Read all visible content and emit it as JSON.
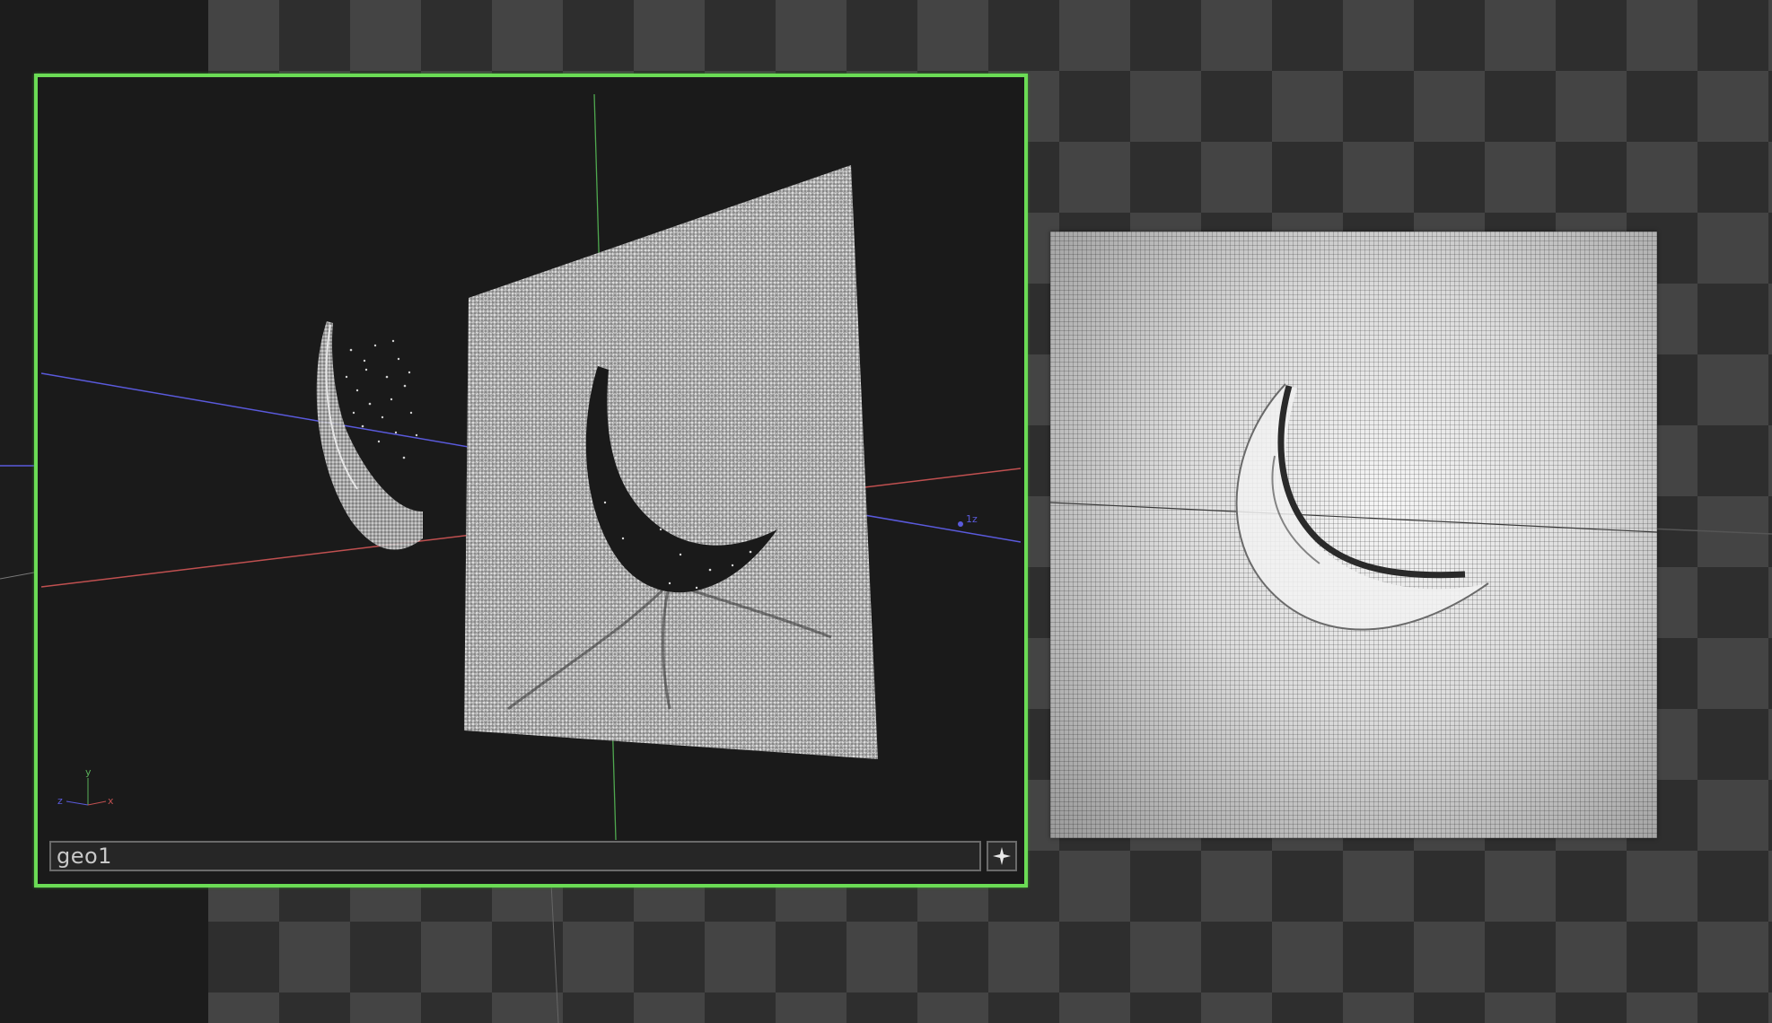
{
  "viewer": {
    "node_name": "geo1",
    "expand_icon": "sparkle-icon",
    "accent_color": "#6bdc55"
  },
  "axes_gizmo": {
    "y": "y",
    "z": "z",
    "x": "x"
  },
  "viewport": {
    "axis_tag": "1z"
  },
  "colors": {
    "grid_blue": "#5a5adc",
    "grid_red": "#c05050",
    "grid_green": "#4fa84f",
    "checker_light": "#444444",
    "checker_dark": "#2e2e2e"
  }
}
